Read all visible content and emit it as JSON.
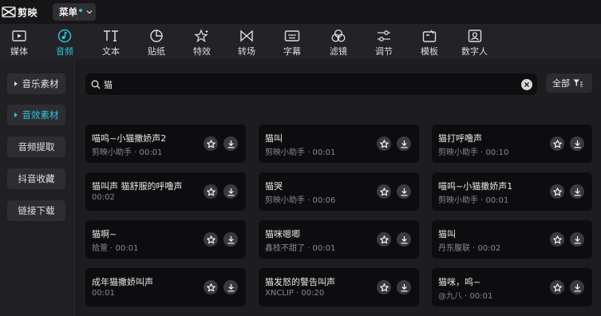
{
  "app": {
    "name": "剪映",
    "menu_label": "菜单"
  },
  "toolbar": [
    {
      "label": "媒体",
      "icon": "media-icon",
      "active": false
    },
    {
      "label": "音频",
      "icon": "audio-icon",
      "active": true
    },
    {
      "label": "文本",
      "icon": "text-icon",
      "active": false
    },
    {
      "label": "贴纸",
      "icon": "sticker-icon",
      "active": false
    },
    {
      "label": "特效",
      "icon": "effects-icon",
      "active": false
    },
    {
      "label": "转场",
      "icon": "transition-icon",
      "active": false
    },
    {
      "label": "字幕",
      "icon": "subtitle-icon",
      "active": false
    },
    {
      "label": "滤镜",
      "icon": "filter-icon",
      "active": false
    },
    {
      "label": "调节",
      "icon": "adjust-icon",
      "active": false
    },
    {
      "label": "模板",
      "icon": "template-icon",
      "active": false
    },
    {
      "label": "数字人",
      "icon": "digital-human-icon",
      "active": false
    }
  ],
  "sidebar": [
    {
      "label": "音乐素材",
      "caret": true,
      "active": false
    },
    {
      "label": "音效素材",
      "caret": true,
      "active": true
    },
    {
      "label": "音频提取",
      "caret": false,
      "active": false
    },
    {
      "label": "抖音收藏",
      "caret": false,
      "active": false
    },
    {
      "label": "链接下载",
      "caret": false,
      "active": false
    }
  ],
  "search": {
    "value": "猫",
    "placeholder": ""
  },
  "filter": {
    "label": "全部"
  },
  "results": [
    {
      "title": "喵呜~小猫撒娇声2",
      "meta": "剪映小助手 · 00:01"
    },
    {
      "title": "猫叫",
      "meta": "剪映小助手 · 00:01"
    },
    {
      "title": "猫打呼噜声",
      "meta": "剪映小助手 · 00:10"
    },
    {
      "title": "猫叫声 猫舒服的呼噜声",
      "meta": "00:02"
    },
    {
      "title": "猫哭",
      "meta": "剪映小助手 · 00:06"
    },
    {
      "title": "喵呜~小猫撒娇声1",
      "meta": "剪映小助手 · 00:01"
    },
    {
      "title": "猫啊~",
      "meta": "拾萱 · 00:01"
    },
    {
      "title": "猫咪嗯唧",
      "meta": "鑫枝不甜了 · 00:01"
    },
    {
      "title": "猫叫",
      "meta": "丹东腹联 · 00:02"
    },
    {
      "title": "成年猫撒娇叫声",
      "meta": "00:01"
    },
    {
      "title": "猫发怒的警告叫声",
      "meta": "XNCLIP · 00:20"
    },
    {
      "title": "猫咪，呜~",
      "meta": "@九八 · 00:01"
    }
  ],
  "colors": {
    "accent": "#2ac7d8",
    "background": "#1b1b1e",
    "card": "#0d0d0f"
  }
}
